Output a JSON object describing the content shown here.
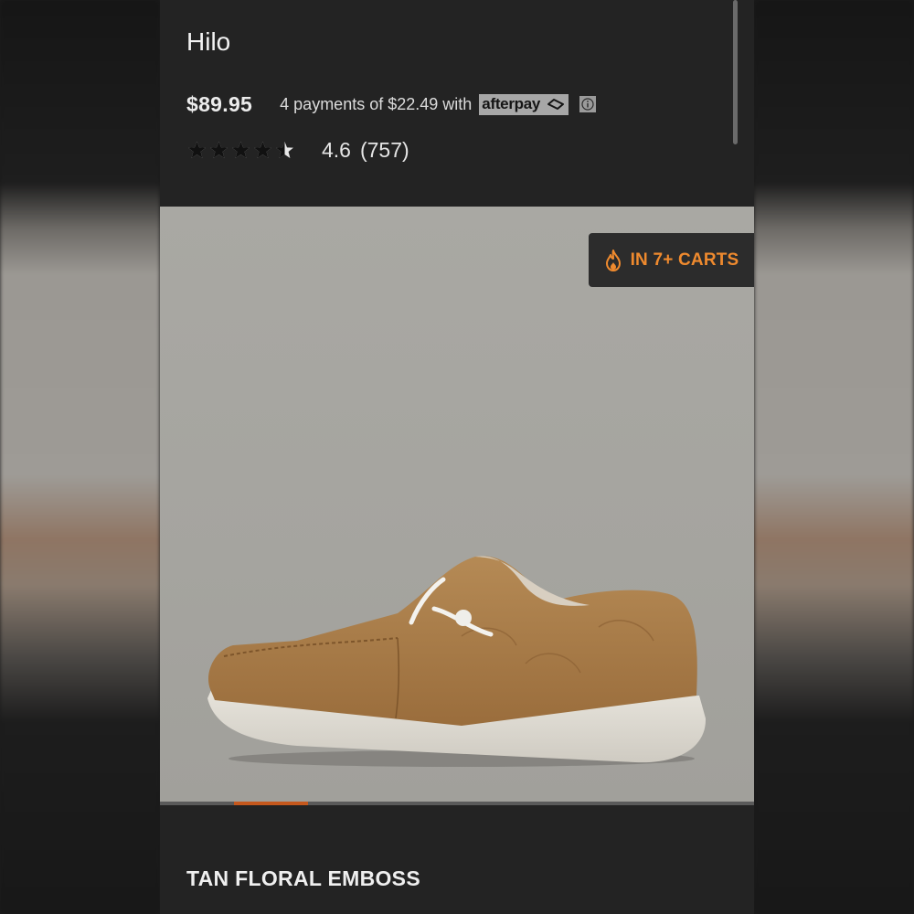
{
  "product": {
    "title": "Hilo",
    "price": "$89.95",
    "installment_text": "4 payments of $22.49 with",
    "afterpay_label": "afterpay",
    "rating_value": "4.6",
    "review_count": "(757)",
    "rating_stars": 4.5,
    "cart_badge": "IN 7+ CARTS",
    "color_name": "TAN FLORAL EMBOSS"
  },
  "carousel": {
    "active_index": 1
  },
  "icons": {
    "badge_icon": "fire-icon",
    "info_icon": "info-icon",
    "afterpay_icon": "afterpay-logo-icon"
  },
  "colors": {
    "accent": "#ef8a2e",
    "carousel_active": "#c5581d",
    "background": "#232323",
    "hero_background": "#a7a6a1"
  }
}
